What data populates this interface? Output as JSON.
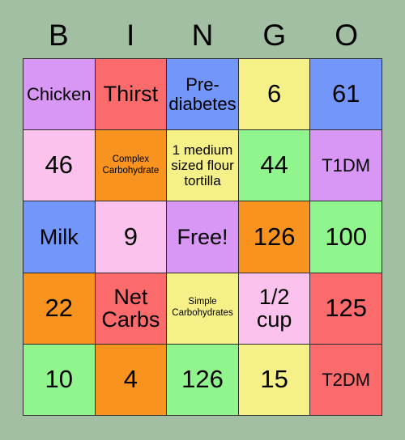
{
  "card": {
    "title": "BINGO",
    "background_color": "#a3bfa3",
    "border_color": "#2b2b2b",
    "header_letters": [
      "B",
      "I",
      "N",
      "G",
      "O"
    ],
    "columns": 5,
    "rows": 5,
    "free_space": {
      "row": 2,
      "column": 2,
      "label": "Free!"
    },
    "palette": {
      "violet": "#d896f5",
      "salmon": "#fb6b6b",
      "blue": "#7296fa",
      "yellow": "#f5f088",
      "pink": "#fbc2ed",
      "orange": "#f7931e",
      "green": "#90f58c"
    },
    "cells": [
      {
        "text": "Chicken",
        "color": "#d896f5",
        "size": "md"
      },
      {
        "text": "Thirst",
        "color": "#fb6b6b",
        "size": "lg"
      },
      {
        "text": "Pre-\ndiabetes",
        "color": "#7296fa",
        "size": "md"
      },
      {
        "text": "6",
        "color": "#f5f088",
        "size": "xl"
      },
      {
        "text": "61",
        "color": "#7296fa",
        "size": "xl"
      },
      {
        "text": "46",
        "color": "#fbc2ed",
        "size": "xl"
      },
      {
        "text": "Complex\nCarbohydrate",
        "color": "#f7931e",
        "size": "xs"
      },
      {
        "text": "1 medium\nsized flour\ntortilla",
        "color": "#f5f088",
        "size": "sm"
      },
      {
        "text": "44",
        "color": "#90f58c",
        "size": "xl"
      },
      {
        "text": "T1DM",
        "color": "#d896f5",
        "size": "md"
      },
      {
        "text": "Milk",
        "color": "#7296fa",
        "size": "lg"
      },
      {
        "text": "9",
        "color": "#fbc2ed",
        "size": "xl"
      },
      {
        "text": "Free!",
        "color": "#d896f5",
        "size": "lg"
      },
      {
        "text": "126",
        "color": "#f7931e",
        "size": "xl"
      },
      {
        "text": "100",
        "color": "#90f58c",
        "size": "xl"
      },
      {
        "text": "22",
        "color": "#f7931e",
        "size": "xl"
      },
      {
        "text": "Net\nCarbs",
        "color": "#fb6b6b",
        "size": "lg"
      },
      {
        "text": "Simple\nCarbohydrates",
        "color": "#f5f088",
        "size": "xs"
      },
      {
        "text": "1/2\ncup",
        "color": "#fbc2ed",
        "size": "lg"
      },
      {
        "text": "125",
        "color": "#fb6b6b",
        "size": "xl"
      },
      {
        "text": "10",
        "color": "#90f58c",
        "size": "xl"
      },
      {
        "text": "4",
        "color": "#f7931e",
        "size": "xl"
      },
      {
        "text": "126",
        "color": "#90f58c",
        "size": "xl"
      },
      {
        "text": "15",
        "color": "#f5f088",
        "size": "xl"
      },
      {
        "text": "T2DM",
        "color": "#fb6b6b",
        "size": "md"
      }
    ]
  }
}
